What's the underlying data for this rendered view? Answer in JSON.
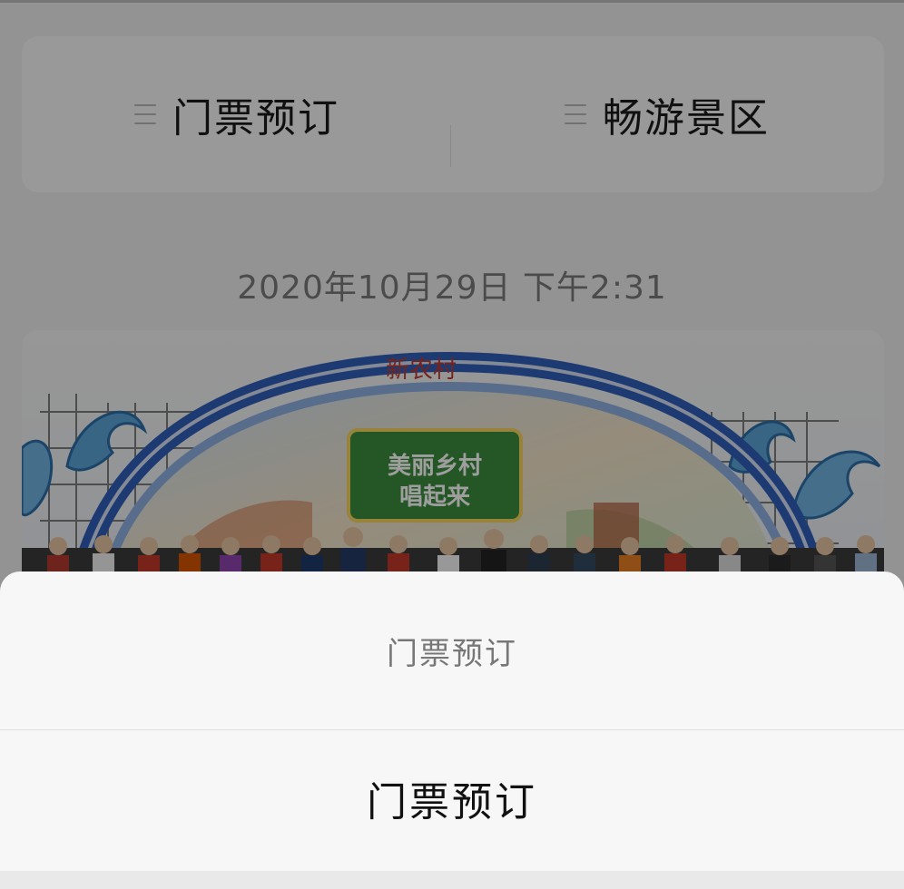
{
  "menu": {
    "items": [
      {
        "label": "门票预订",
        "icon": "list-icon"
      },
      {
        "label": "畅游景区",
        "icon": "list-icon"
      }
    ]
  },
  "timestamp": "2020年10月29日 下午2:31",
  "article_image": {
    "sign_text": "美丽乡村唱起来",
    "arch_text": "新农村"
  },
  "action_sheet": {
    "title": "门票预订",
    "option": "门票预订"
  },
  "colors": {
    "background": "#ededed",
    "card": "#f7f7f7",
    "overlay": "rgba(0,0,0,0.38)",
    "arch_blue": "#2f5fb8"
  }
}
